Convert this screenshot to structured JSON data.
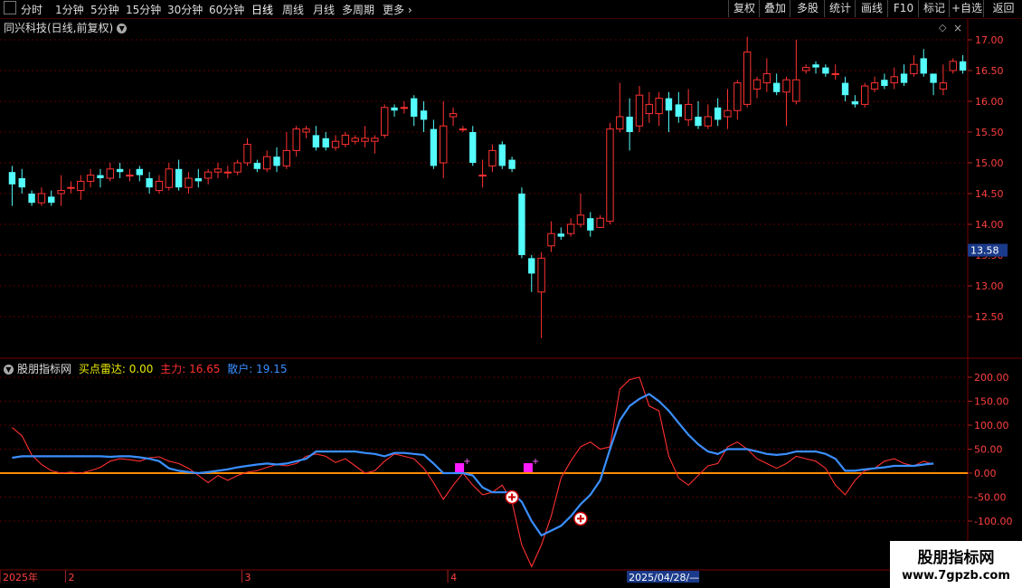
{
  "toolbar": {
    "left_items": [
      "分时",
      "1分钟",
      "5分钟",
      "15分钟",
      "30分钟",
      "60分钟",
      "日线",
      "周线",
      "月线",
      "多周期",
      "更多"
    ],
    "active_index": 6,
    "right_items": [
      "复权",
      "叠加",
      "多股",
      "统计",
      "画线",
      "F10",
      "标记",
      "+自选",
      "返回"
    ]
  },
  "main_title": "同兴科技(日线,前复权)",
  "indicator": {
    "name": "股朋指标网",
    "label_buy": "买点雷达: 0.00",
    "label_main": "主力: 16.65",
    "label_retail": "散户: 19.15",
    "colors": {
      "buy": "#e8e800",
      "main": "#ff3030",
      "retail": "#3a8fff",
      "zero_line": "#ff8c00"
    }
  },
  "chart_data": [
    {
      "type": "candlestick",
      "title": "同兴科技(日线,前复权)",
      "colors": {
        "up": "#ff3232",
        "down": "#54fcfc"
      },
      "y_ticks": [
        12.5,
        13.0,
        13.5,
        14.0,
        14.5,
        15.0,
        15.5,
        16.0,
        16.5,
        17.0
      ],
      "ylim": [
        12.0,
        17.2
      ],
      "price_marker": 13.58,
      "candles": [
        [
          14.85,
          14.65,
          14.95,
          14.3
        ],
        [
          14.75,
          14.6,
          14.9,
          14.5
        ],
        [
          14.5,
          14.35,
          14.55,
          14.3
        ],
        [
          14.35,
          14.5,
          14.6,
          14.3
        ],
        [
          14.45,
          14.35,
          14.55,
          14.3
        ],
        [
          14.5,
          14.55,
          14.8,
          14.3
        ],
        [
          14.6,
          14.6,
          14.7,
          14.5
        ],
        [
          14.55,
          14.7,
          14.8,
          14.4
        ],
        [
          14.7,
          14.8,
          14.9,
          14.6
        ],
        [
          14.8,
          14.75,
          14.9,
          14.6
        ],
        [
          14.75,
          14.9,
          15.0,
          14.7
        ],
        [
          14.9,
          14.85,
          15.0,
          14.75
        ],
        [
          14.8,
          14.8,
          14.9,
          14.7
        ],
        [
          14.9,
          14.8,
          14.95,
          14.7
        ],
        [
          14.75,
          14.6,
          14.85,
          14.5
        ],
        [
          14.55,
          14.7,
          14.8,
          14.5
        ],
        [
          14.6,
          14.9,
          15.0,
          14.55
        ],
        [
          14.9,
          14.6,
          15.05,
          14.55
        ],
        [
          14.6,
          14.75,
          14.85,
          14.5
        ],
        [
          14.75,
          14.7,
          14.9,
          14.6
        ],
        [
          14.75,
          14.85,
          14.9,
          14.65
        ],
        [
          14.85,
          14.9,
          15.0,
          14.75
        ],
        [
          14.85,
          14.85,
          14.95,
          14.75
        ],
        [
          14.85,
          15.0,
          15.05,
          14.8
        ],
        [
          15.0,
          15.3,
          15.4,
          14.95
        ],
        [
          15.0,
          14.9,
          15.05,
          14.85
        ],
        [
          14.9,
          15.1,
          15.2,
          14.85
        ],
        [
          15.1,
          14.95,
          15.25,
          14.85
        ],
        [
          14.95,
          15.2,
          15.5,
          14.9
        ],
        [
          15.2,
          15.55,
          15.6,
          15.1
        ],
        [
          15.5,
          15.55,
          15.6,
          15.4
        ],
        [
          15.45,
          15.25,
          15.6,
          15.2
        ],
        [
          15.4,
          15.25,
          15.5,
          15.2
        ],
        [
          15.25,
          15.35,
          15.45,
          15.2
        ],
        [
          15.3,
          15.45,
          15.5,
          15.25
        ],
        [
          15.35,
          15.4,
          15.45,
          15.3
        ],
        [
          15.35,
          15.4,
          15.6,
          15.25
        ],
        [
          15.35,
          15.4,
          15.45,
          15.15
        ],
        [
          15.45,
          15.9,
          15.95,
          15.4
        ],
        [
          15.9,
          15.85,
          15.95,
          15.75
        ],
        [
          15.9,
          15.9,
          16.0,
          15.8
        ],
        [
          16.05,
          15.75,
          16.1,
          15.6
        ],
        [
          15.85,
          15.7,
          16.0,
          15.5
        ],
        [
          15.55,
          14.95,
          15.7,
          14.9
        ],
        [
          15.0,
          15.6,
          16.0,
          14.75
        ],
        [
          15.75,
          15.8,
          15.9,
          15.6
        ],
        [
          15.55,
          15.55,
          15.6,
          15.5
        ],
        [
          15.5,
          15.0,
          15.6,
          14.95
        ],
        [
          14.8,
          14.8,
          15.05,
          14.6
        ],
        [
          14.95,
          15.2,
          15.3,
          14.85
        ],
        [
          15.3,
          14.95,
          15.35,
          14.9
        ],
        [
          15.05,
          14.9,
          15.1,
          14.85
        ],
        [
          14.5,
          13.5,
          14.6,
          13.45
        ],
        [
          13.45,
          13.2,
          13.5,
          12.9
        ],
        [
          12.9,
          13.45,
          13.55,
          12.15
        ],
        [
          13.65,
          13.85,
          14.05,
          13.55
        ],
        [
          13.85,
          13.8,
          13.95,
          13.75
        ],
        [
          13.85,
          14.0,
          14.1,
          13.8
        ],
        [
          14.0,
          14.15,
          14.5,
          13.95
        ],
        [
          14.1,
          13.9,
          14.2,
          13.8
        ],
        [
          13.95,
          14.1,
          14.15,
          13.95
        ],
        [
          14.05,
          15.55,
          15.65,
          14.0
        ],
        [
          15.55,
          15.75,
          16.3,
          15.5
        ],
        [
          15.75,
          15.5,
          16.05,
          15.2
        ],
        [
          15.6,
          16.1,
          16.25,
          15.5
        ],
        [
          15.8,
          15.95,
          16.15,
          15.65
        ],
        [
          15.8,
          16.05,
          16.15,
          15.6
        ],
        [
          16.05,
          15.85,
          16.15,
          15.5
        ],
        [
          15.95,
          15.75,
          16.15,
          15.65
        ],
        [
          15.7,
          15.95,
          16.2,
          15.6
        ],
        [
          15.75,
          15.6,
          16.0,
          15.55
        ],
        [
          15.6,
          15.75,
          15.95,
          15.55
        ],
        [
          15.9,
          15.7,
          16.05,
          15.6
        ],
        [
          15.75,
          15.85,
          16.2,
          15.55
        ],
        [
          15.85,
          16.3,
          16.35,
          15.7
        ],
        [
          15.95,
          16.8,
          17.05,
          15.9
        ],
        [
          16.2,
          16.35,
          16.4,
          16.05
        ],
        [
          16.3,
          16.45,
          16.7,
          16.15
        ],
        [
          16.3,
          16.15,
          16.45,
          16.1
        ],
        [
          16.15,
          16.35,
          16.4,
          15.6
        ],
        [
          16.0,
          16.35,
          17.0,
          15.95
        ],
        [
          16.5,
          16.55,
          16.6,
          16.45
        ],
        [
          16.6,
          16.55,
          16.65,
          16.45
        ],
        [
          16.55,
          16.45,
          16.6,
          16.4
        ],
        [
          16.45,
          16.45,
          16.6,
          16.35
        ],
        [
          16.3,
          16.1,
          16.4,
          16.0
        ],
        [
          16.0,
          15.95,
          16.1,
          15.9
        ],
        [
          15.95,
          16.25,
          16.3,
          15.9
        ],
        [
          16.2,
          16.3,
          16.4,
          16.15
        ],
        [
          16.35,
          16.25,
          16.45,
          16.2
        ],
        [
          16.3,
          16.4,
          16.55,
          16.2
        ],
        [
          16.45,
          16.3,
          16.6,
          16.25
        ],
        [
          16.45,
          16.6,
          16.75,
          16.4
        ],
        [
          16.7,
          16.45,
          16.85,
          16.4
        ],
        [
          16.45,
          16.3,
          16.45,
          16.1
        ],
        [
          16.2,
          16.3,
          16.6,
          16.1
        ],
        [
          16.5,
          16.65,
          16.7,
          16.45
        ],
        [
          16.65,
          16.5,
          16.75,
          16.45
        ]
      ],
      "x_labels": [
        {
          "label": "2025年",
          "index": 0
        },
        {
          "label": "2",
          "index": 6
        },
        {
          "label": "3",
          "index": 24
        },
        {
          "label": "4",
          "index": 45
        },
        {
          "label": "2025/04/28/—",
          "index": 63
        }
      ]
    },
    {
      "type": "line",
      "title": "股朋指标网",
      "y_ticks": [
        200.0,
        150.0,
        100.0,
        50.0,
        0.0,
        -50.0,
        -100.0
      ],
      "ylim": [
        -190,
        215
      ],
      "series": [
        {
          "name": "主力",
          "color": "#ff3030",
          "values": [
            95,
            78,
            38,
            18,
            5,
            0,
            2,
            0,
            5,
            12,
            25,
            30,
            28,
            25,
            32,
            34,
            25,
            20,
            10,
            -5,
            -20,
            -5,
            -15,
            -5,
            2,
            5,
            12,
            18,
            15,
            20,
            35,
            40,
            35,
            22,
            30,
            15,
            0,
            5,
            25,
            40,
            35,
            30,
            10,
            -20,
            -55,
            -25,
            0,
            -25,
            -45,
            -40,
            -25,
            -60,
            -150,
            -195,
            -150,
            -90,
            -10,
            25,
            55,
            65,
            50,
            55,
            175,
            195,
            200,
            140,
            130,
            35,
            -10,
            -25,
            -5,
            15,
            20,
            55,
            65,
            50,
            30,
            20,
            10,
            20,
            35,
            30,
            25,
            10,
            -25,
            -45,
            -15,
            5,
            10,
            25,
            30,
            20,
            15,
            25,
            18
          ]
        },
        {
          "name": "散户",
          "color": "#3a8fff",
          "values": [
            32,
            35,
            35,
            35,
            35,
            35,
            35,
            35,
            35,
            35,
            34,
            35,
            35,
            33,
            30,
            25,
            10,
            5,
            2,
            0,
            2,
            5,
            8,
            12,
            15,
            18,
            20,
            18,
            20,
            25,
            30,
            45,
            45,
            45,
            45,
            45,
            42,
            40,
            35,
            42,
            42,
            40,
            38,
            20,
            0,
            0,
            0,
            -5,
            -30,
            -40,
            -40,
            -40,
            -60,
            -100,
            -130,
            -120,
            -110,
            -90,
            -65,
            -45,
            -15,
            50,
            110,
            140,
            155,
            165,
            150,
            130,
            105,
            80,
            60,
            45,
            40,
            50,
            50,
            50,
            45,
            40,
            38,
            40,
            45,
            45,
            45,
            40,
            30,
            5,
            5,
            8,
            10,
            12,
            15,
            15,
            15,
            18,
            20
          ]
        }
      ],
      "markers": [
        {
          "label": "Buy",
          "index": 51,
          "value": -50
        },
        {
          "label": "Buy",
          "index": 58,
          "value": -95
        }
      ]
    }
  ]
}
